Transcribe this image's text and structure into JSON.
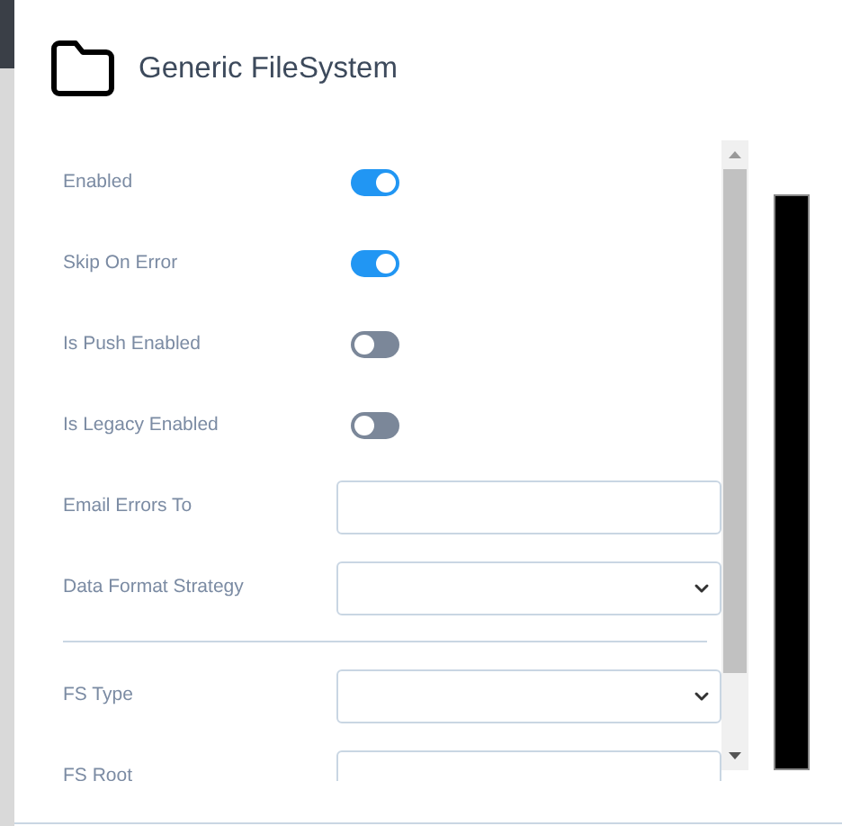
{
  "dialog": {
    "title": "Generic FileSystem"
  },
  "fields": [
    {
      "kind": "toggle",
      "label": "Enabled",
      "on": true
    },
    {
      "kind": "toggle",
      "label": "Skip On Error",
      "on": true
    },
    {
      "kind": "toggle",
      "label": "Is Push Enabled",
      "on": false
    },
    {
      "kind": "toggle",
      "label": "Is Legacy Enabled",
      "on": false
    },
    {
      "kind": "text",
      "label": "Email Errors To"
    },
    {
      "kind": "select",
      "label": "Data Format Strategy"
    },
    {
      "kind": "divider"
    },
    {
      "kind": "select",
      "label": "FS Type"
    },
    {
      "kind": "text",
      "label": "FS Root"
    }
  ]
}
